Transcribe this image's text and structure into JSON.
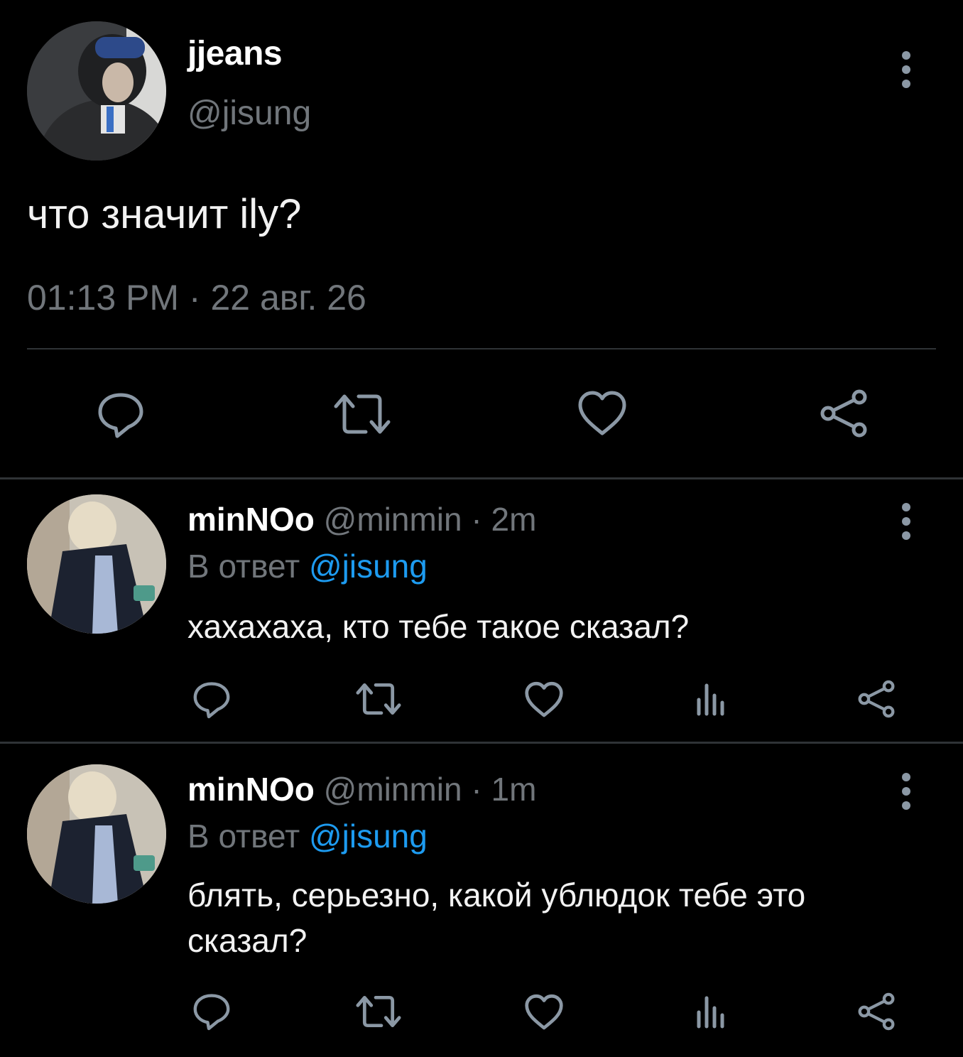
{
  "main_tweet": {
    "display_name": "jjeans",
    "handle": "@jisung",
    "text": "что значит ily?",
    "timestamp": "01:13 PM · 22 авг. 26",
    "actions": {
      "reply_icon": "reply-bubble-icon",
      "retweet_icon": "retweet-icon",
      "like_icon": "heart-icon",
      "share_icon": "share-icon"
    }
  },
  "replies": [
    {
      "display_name": "minNOo",
      "handle": "@minmin",
      "dot": "·",
      "time": "2m",
      "reply_prefix": "В ответ",
      "mention": "@jisung",
      "text": "хахахаха, кто тебе такое сказал?"
    },
    {
      "display_name": "minNOo",
      "handle": "@minmin",
      "dot": "·",
      "time": "1m",
      "reply_prefix": "В ответ",
      "mention": "@jisung",
      "text": "блять, серьезно, какой ублюдок тебе это сказал?"
    }
  ],
  "colors": {
    "background": "#000000",
    "text": "#e7e9ea",
    "muted": "#71767b",
    "link": "#1d9bf0",
    "icon": "#8b98a5",
    "divider": "#2f3336"
  }
}
